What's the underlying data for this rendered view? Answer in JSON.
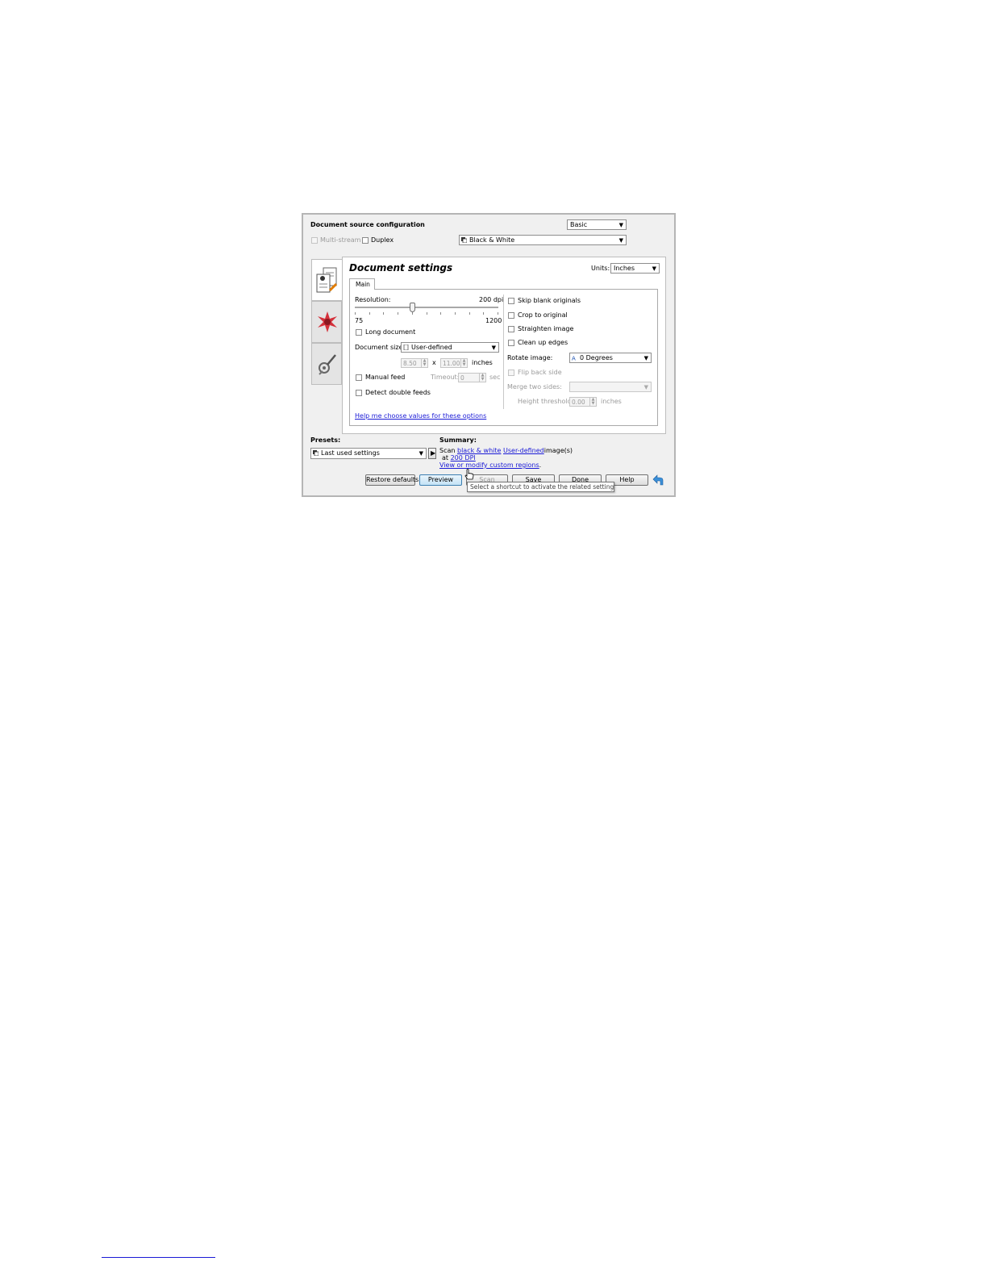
{
  "header": {
    "title": "Document source configuration",
    "mode_select": "Basic",
    "multistream_label": "Multi-stream",
    "duplex_label": "Duplex",
    "color_select": "Black & White"
  },
  "settings": {
    "title": "Document settings",
    "units_label": "Units:",
    "units_select": "Inches",
    "tab_main": "Main",
    "resolution_label": "Resolution:",
    "resolution_value": "200 dpi",
    "resolution_min": "75",
    "resolution_max": "1200",
    "resolution_level": 0.4,
    "long_document_label": "Long document",
    "document_size_label": "Document size:",
    "document_size_select": "User-defined",
    "width_value": "8.50",
    "times_symbol": "x",
    "height_value": "11.00",
    "size_unit": "inches",
    "manual_feed_label": "Manual feed",
    "timeout_label": "Timeout:",
    "timeout_value": "0",
    "timeout_unit": "sec",
    "detect_double_label": "Detect double feeds",
    "help_link": "Help me choose values for these options",
    "skip_blank_label": "Skip blank originals",
    "crop_label": "Crop to original",
    "straighten_label": "Straighten image",
    "cleanup_label": "Clean up edges",
    "rotate_label": "Rotate image:",
    "rotate_select": "0 Degrees",
    "flip_label": "Flip back side",
    "merge_label": "Merge two sides:",
    "height_threshold_label": "Height threshold:",
    "height_threshold_value": "0.00",
    "height_threshold_unit": "inches"
  },
  "presets": {
    "label": "Presets:",
    "select": "Last used settings"
  },
  "summary": {
    "label": "Summary:",
    "scan_word": "Scan",
    "color_link": "black & white",
    "size_link": "User-defined",
    "images_word": "image(s)",
    "at_word": "at",
    "dpi_link": "200 DPI",
    "regions_link": "View or modify custom regions",
    "period": "."
  },
  "buttons": {
    "restore_defaults": "Restore defaults",
    "preview": "Preview",
    "scan": "Scan",
    "save": "Save",
    "done": "Done",
    "help": "Help"
  },
  "tooltip": "Select a shortcut to activate the related setting",
  "icons": [
    "document-settings-icon",
    "image-enhancement-icon",
    "advanced-settings-icon",
    "undo-arrow-icon",
    "hand-cursor-icon"
  ],
  "colors": {
    "link": "#1a1ad6",
    "dialog_bg": "#f0f0f0",
    "preview_border": "#3c7fb1"
  }
}
